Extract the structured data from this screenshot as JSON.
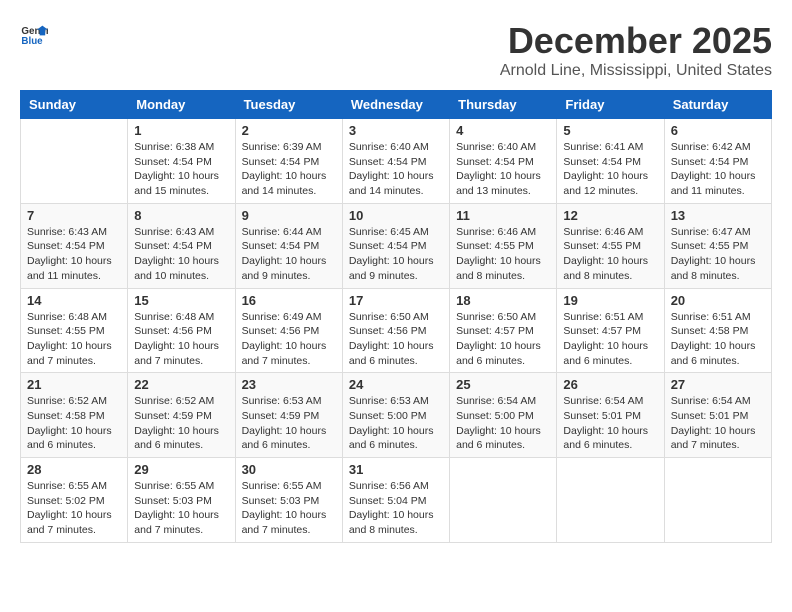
{
  "header": {
    "logo_general": "General",
    "logo_blue": "Blue",
    "month_title": "December 2025",
    "location": "Arnold Line, Mississippi, United States"
  },
  "calendar": {
    "days_of_week": [
      "Sunday",
      "Monday",
      "Tuesday",
      "Wednesday",
      "Thursday",
      "Friday",
      "Saturday"
    ],
    "weeks": [
      [
        {
          "day": "",
          "info": ""
        },
        {
          "day": "1",
          "info": "Sunrise: 6:38 AM\nSunset: 4:54 PM\nDaylight: 10 hours\nand 15 minutes."
        },
        {
          "day": "2",
          "info": "Sunrise: 6:39 AM\nSunset: 4:54 PM\nDaylight: 10 hours\nand 14 minutes."
        },
        {
          "day": "3",
          "info": "Sunrise: 6:40 AM\nSunset: 4:54 PM\nDaylight: 10 hours\nand 14 minutes."
        },
        {
          "day": "4",
          "info": "Sunrise: 6:40 AM\nSunset: 4:54 PM\nDaylight: 10 hours\nand 13 minutes."
        },
        {
          "day": "5",
          "info": "Sunrise: 6:41 AM\nSunset: 4:54 PM\nDaylight: 10 hours\nand 12 minutes."
        },
        {
          "day": "6",
          "info": "Sunrise: 6:42 AM\nSunset: 4:54 PM\nDaylight: 10 hours\nand 11 minutes."
        }
      ],
      [
        {
          "day": "7",
          "info": "Sunrise: 6:43 AM\nSunset: 4:54 PM\nDaylight: 10 hours\nand 11 minutes."
        },
        {
          "day": "8",
          "info": "Sunrise: 6:43 AM\nSunset: 4:54 PM\nDaylight: 10 hours\nand 10 minutes."
        },
        {
          "day": "9",
          "info": "Sunrise: 6:44 AM\nSunset: 4:54 PM\nDaylight: 10 hours\nand 9 minutes."
        },
        {
          "day": "10",
          "info": "Sunrise: 6:45 AM\nSunset: 4:54 PM\nDaylight: 10 hours\nand 9 minutes."
        },
        {
          "day": "11",
          "info": "Sunrise: 6:46 AM\nSunset: 4:55 PM\nDaylight: 10 hours\nand 8 minutes."
        },
        {
          "day": "12",
          "info": "Sunrise: 6:46 AM\nSunset: 4:55 PM\nDaylight: 10 hours\nand 8 minutes."
        },
        {
          "day": "13",
          "info": "Sunrise: 6:47 AM\nSunset: 4:55 PM\nDaylight: 10 hours\nand 8 minutes."
        }
      ],
      [
        {
          "day": "14",
          "info": "Sunrise: 6:48 AM\nSunset: 4:55 PM\nDaylight: 10 hours\nand 7 minutes."
        },
        {
          "day": "15",
          "info": "Sunrise: 6:48 AM\nSunset: 4:56 PM\nDaylight: 10 hours\nand 7 minutes."
        },
        {
          "day": "16",
          "info": "Sunrise: 6:49 AM\nSunset: 4:56 PM\nDaylight: 10 hours\nand 7 minutes."
        },
        {
          "day": "17",
          "info": "Sunrise: 6:50 AM\nSunset: 4:56 PM\nDaylight: 10 hours\nand 6 minutes."
        },
        {
          "day": "18",
          "info": "Sunrise: 6:50 AM\nSunset: 4:57 PM\nDaylight: 10 hours\nand 6 minutes."
        },
        {
          "day": "19",
          "info": "Sunrise: 6:51 AM\nSunset: 4:57 PM\nDaylight: 10 hours\nand 6 minutes."
        },
        {
          "day": "20",
          "info": "Sunrise: 6:51 AM\nSunset: 4:58 PM\nDaylight: 10 hours\nand 6 minutes."
        }
      ],
      [
        {
          "day": "21",
          "info": "Sunrise: 6:52 AM\nSunset: 4:58 PM\nDaylight: 10 hours\nand 6 minutes."
        },
        {
          "day": "22",
          "info": "Sunrise: 6:52 AM\nSunset: 4:59 PM\nDaylight: 10 hours\nand 6 minutes."
        },
        {
          "day": "23",
          "info": "Sunrise: 6:53 AM\nSunset: 4:59 PM\nDaylight: 10 hours\nand 6 minutes."
        },
        {
          "day": "24",
          "info": "Sunrise: 6:53 AM\nSunset: 5:00 PM\nDaylight: 10 hours\nand 6 minutes."
        },
        {
          "day": "25",
          "info": "Sunrise: 6:54 AM\nSunset: 5:00 PM\nDaylight: 10 hours\nand 6 minutes."
        },
        {
          "day": "26",
          "info": "Sunrise: 6:54 AM\nSunset: 5:01 PM\nDaylight: 10 hours\nand 6 minutes."
        },
        {
          "day": "27",
          "info": "Sunrise: 6:54 AM\nSunset: 5:01 PM\nDaylight: 10 hours\nand 7 minutes."
        }
      ],
      [
        {
          "day": "28",
          "info": "Sunrise: 6:55 AM\nSunset: 5:02 PM\nDaylight: 10 hours\nand 7 minutes."
        },
        {
          "day": "29",
          "info": "Sunrise: 6:55 AM\nSunset: 5:03 PM\nDaylight: 10 hours\nand 7 minutes."
        },
        {
          "day": "30",
          "info": "Sunrise: 6:55 AM\nSunset: 5:03 PM\nDaylight: 10 hours\nand 7 minutes."
        },
        {
          "day": "31",
          "info": "Sunrise: 6:56 AM\nSunset: 5:04 PM\nDaylight: 10 hours\nand 8 minutes."
        },
        {
          "day": "",
          "info": ""
        },
        {
          "day": "",
          "info": ""
        },
        {
          "day": "",
          "info": ""
        }
      ]
    ]
  }
}
